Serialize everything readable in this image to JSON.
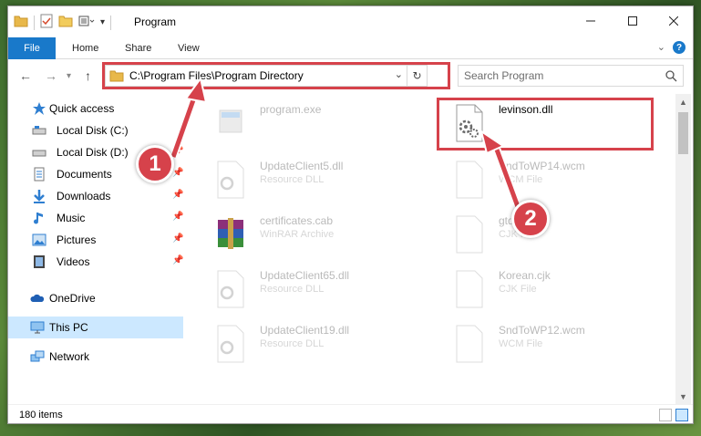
{
  "window": {
    "title": "Program",
    "file_tab": "File",
    "tabs": [
      "Home",
      "Share",
      "View"
    ],
    "help": "?"
  },
  "nav": {
    "address": "C:\\Program Files\\Program Directory",
    "search_placeholder": "Search Program"
  },
  "sidebar": {
    "items": [
      {
        "label": "Quick access",
        "icon": "star-icon",
        "pinned": false
      },
      {
        "label": "Local Disk (C:)",
        "icon": "drive-icon",
        "pinned": false
      },
      {
        "label": "Local Disk (D:)",
        "icon": "drive-icon",
        "pinned": true
      },
      {
        "label": "Documents",
        "icon": "documents-icon",
        "pinned": true
      },
      {
        "label": "Downloads",
        "icon": "download-icon",
        "pinned": true
      },
      {
        "label": "Music",
        "icon": "music-icon",
        "pinned": true
      },
      {
        "label": "Pictures",
        "icon": "pictures-icon",
        "pinned": true
      },
      {
        "label": "Videos",
        "icon": "videos-icon",
        "pinned": true
      },
      {
        "label": "OneDrive",
        "icon": "cloud-icon",
        "pinned": false
      },
      {
        "label": "This PC",
        "icon": "computer-icon",
        "pinned": false
      },
      {
        "label": "Network",
        "icon": "network-icon",
        "pinned": false
      }
    ]
  },
  "files": {
    "program": {
      "name": "program.exe",
      "type": ""
    },
    "levinson": {
      "name": "levinson.dll",
      "type": ""
    },
    "update5": {
      "name": "UpdateClient5.dll",
      "type": "Resource DLL"
    },
    "wcm14": {
      "name": "SndToWP14.wcm",
      "type": "WCM File"
    },
    "cert": {
      "name": "certificates.cab",
      "type": "WinRAR Archive"
    },
    "gtd": {
      "name": "gtd.cjk",
      "type": "CJK File"
    },
    "update65": {
      "name": "UpdateClient65.dll",
      "type": "Resource DLL"
    },
    "korean": {
      "name": "Korean.cjk",
      "type": "CJK File"
    },
    "update19": {
      "name": "UpdateClient19.dll",
      "type": "Resource DLL"
    },
    "wcm12": {
      "name": "SndToWP12.wcm",
      "type": "WCM File"
    }
  },
  "status": {
    "item_count": "180 items"
  },
  "callouts": {
    "one": "1",
    "two": "2"
  },
  "colors": {
    "accent": "#1979ca",
    "highlight": "#d6424b",
    "selected": "#cce8ff"
  }
}
